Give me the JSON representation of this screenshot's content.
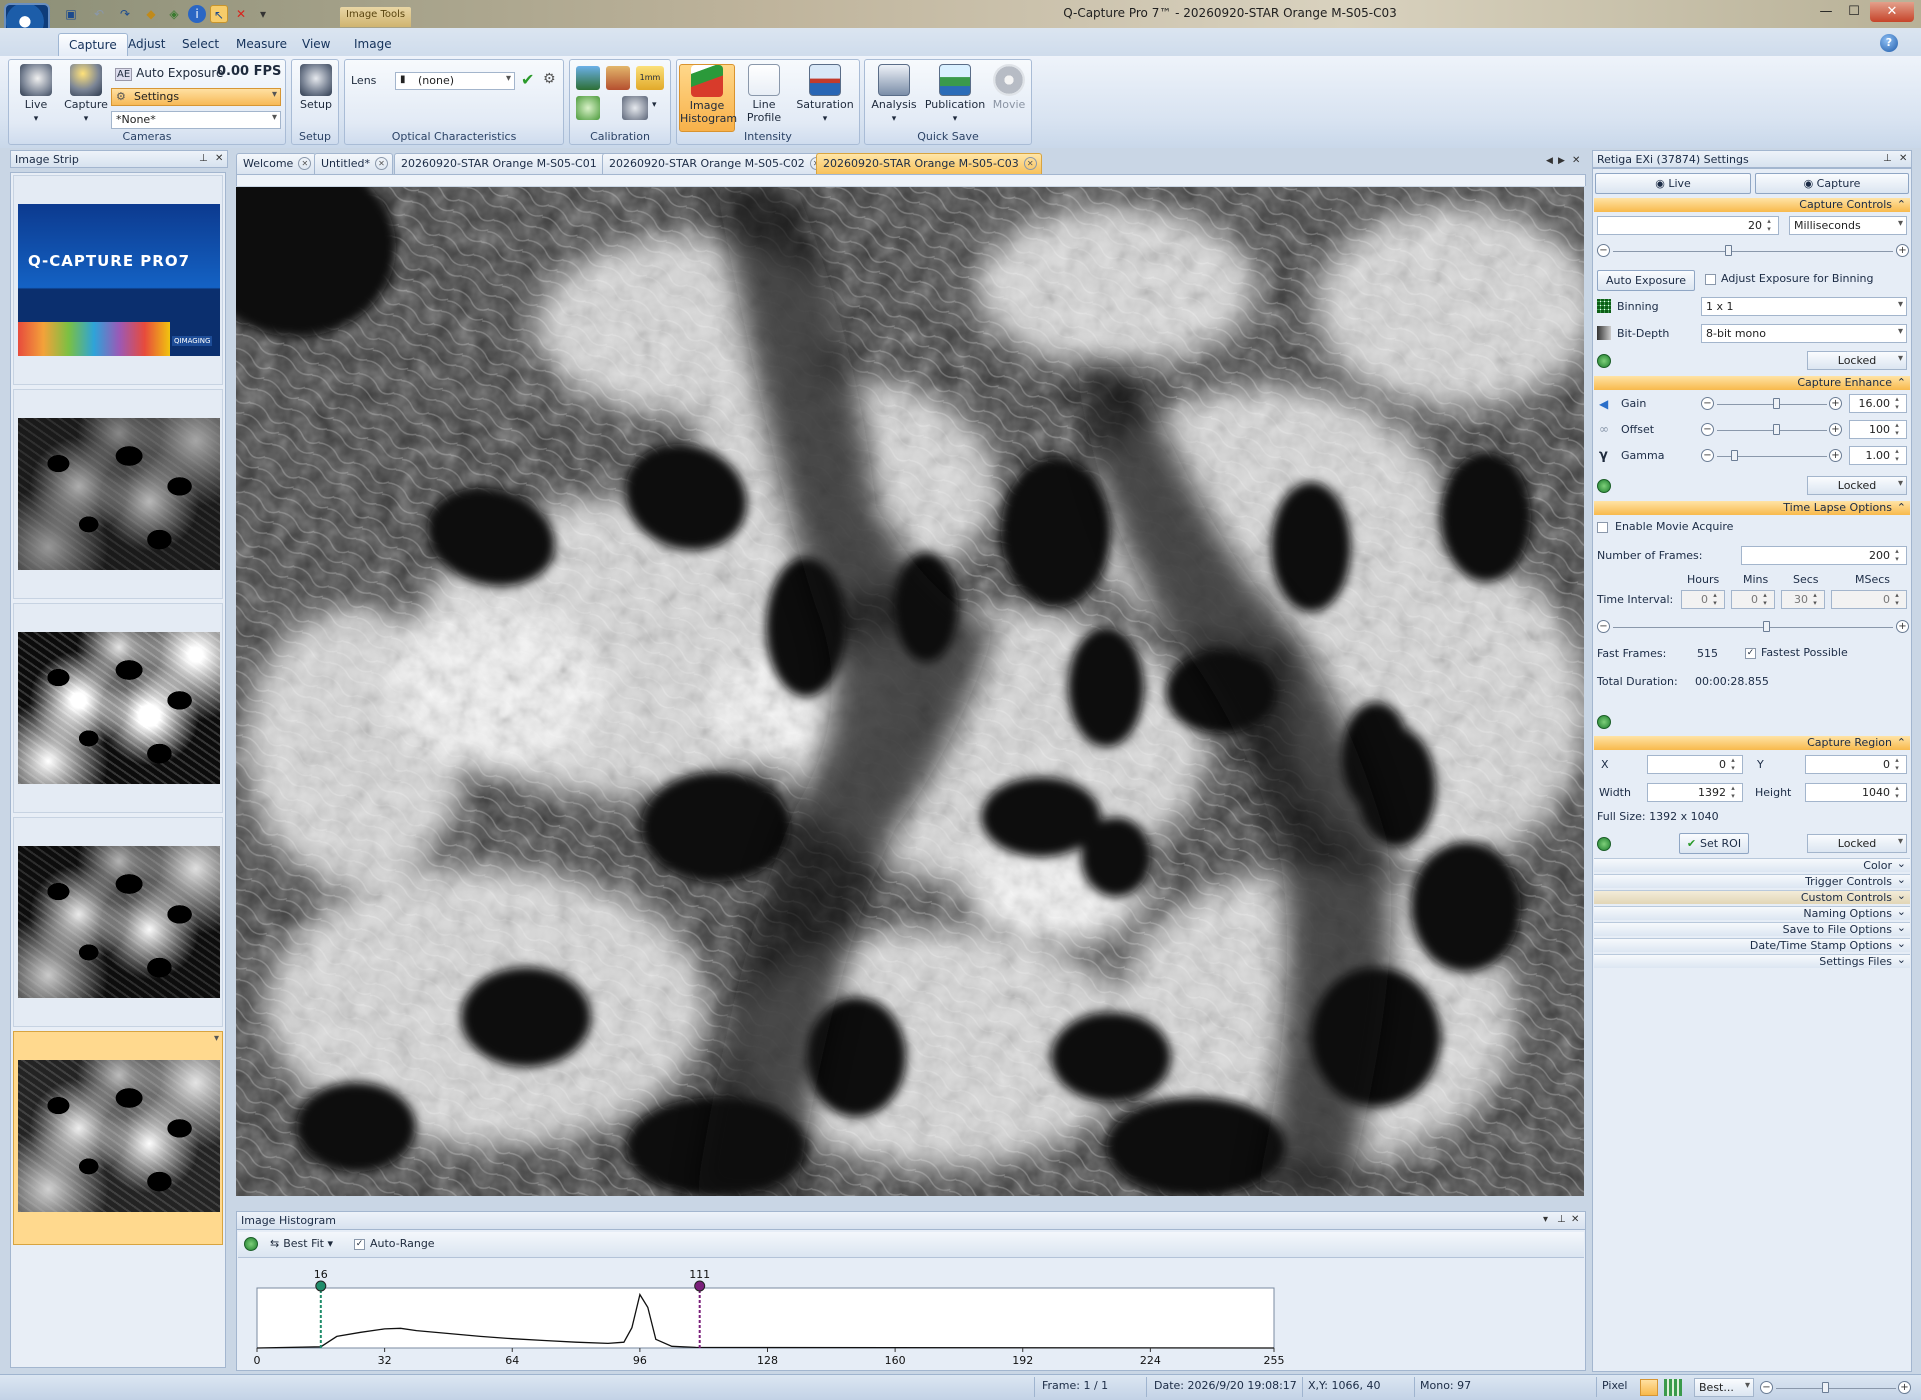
{
  "window": {
    "title": "Q-Capture Pro 7™ - 20260920-STAR Orange M-S05-C03",
    "context_tab": "Image Tools",
    "min": "—",
    "max": "☐",
    "close": "✕"
  },
  "ribbon": {
    "tabs": [
      "Capture",
      "Adjust",
      "Select",
      "Measure",
      "View",
      "Image"
    ],
    "help": "?",
    "cameras": {
      "live": "Live",
      "capture": "Capture",
      "auto_exposure": "Auto Exposure",
      "fps": "0.00 FPS",
      "settings_combo": "Settings",
      "preset_combo": "*None*",
      "label": "Cameras"
    },
    "setup": {
      "button": "Setup",
      "label": "Setup"
    },
    "optical": {
      "lens": "Lens",
      "lens_value": "(none)",
      "label": "Optical Characteristics"
    },
    "calibration": {
      "label": "Calibration"
    },
    "intensity": {
      "histogram": "Image Histogram",
      "line_profile": "Line Profile",
      "saturation": "Saturation",
      "label": "Intensity"
    },
    "quicksave": {
      "analysis": "Analysis",
      "publication": "Publication",
      "movie": "Movie",
      "label": "Quick Save"
    }
  },
  "image_strip": {
    "title": "Image Strip",
    "splash_text": "Q-CAPTURE PRO7",
    "splash_badge": "QIMAGING"
  },
  "doc_tabs": [
    {
      "label": "Welcome"
    },
    {
      "label": "Untitled*"
    },
    {
      "label": "20260920-STAR Orange M-S05-C01"
    },
    {
      "label": "20260920-STAR Orange M-S05-C02"
    },
    {
      "label": "20260920-STAR Orange M-S05-C03"
    }
  ],
  "histogram": {
    "title": "Image Histogram",
    "fit": "Best Fit",
    "auto_range": "Auto-Range",
    "low_marker": 16,
    "high_marker": 111,
    "x_ticks": [
      0,
      32,
      64,
      96,
      128,
      160,
      192,
      224,
      255
    ],
    "curve": [
      [
        0,
        0
      ],
      [
        16,
        0.02
      ],
      [
        20,
        0.2
      ],
      [
        26,
        0.27
      ],
      [
        32,
        0.33
      ],
      [
        36,
        0.34
      ],
      [
        40,
        0.3
      ],
      [
        48,
        0.25
      ],
      [
        56,
        0.2
      ],
      [
        64,
        0.16
      ],
      [
        72,
        0.13
      ],
      [
        80,
        0.1
      ],
      [
        88,
        0.08
      ],
      [
        92,
        0.1
      ],
      [
        94,
        0.35
      ],
      [
        96,
        0.92
      ],
      [
        98,
        0.7
      ],
      [
        100,
        0.15
      ],
      [
        104,
        0.03
      ],
      [
        110,
        0.01
      ],
      [
        255,
        0
      ]
    ]
  },
  "settings": {
    "title": "Retiga EXi (37874) Settings",
    "live_btn": "Live",
    "capture_btn": "Capture",
    "capture_controls": {
      "header": "Capture Controls",
      "exposure": "20",
      "unit": "Milliseconds",
      "auto_exposure_btn": "Auto Exposure",
      "adjust_binning": "Adjust Exposure for Binning",
      "binning_label": "Binning",
      "binning": "1 x 1",
      "bitdepth_label": "Bit-Depth",
      "bitdepth": "8-bit mono",
      "locked": "Locked"
    },
    "capture_enhance": {
      "header": "Capture Enhance",
      "gain_label": "Gain",
      "gain": "16.00",
      "offset_label": "Offset",
      "offset": "100",
      "gamma_label": "Gamma",
      "gamma": "1.00",
      "locked": "Locked"
    },
    "time_lapse": {
      "header": "Time Lapse Options",
      "enable_movie": "Enable Movie Acquire",
      "frames_label": "Number of Frames:",
      "frames": "200",
      "hours_h": "Hours",
      "mins_h": "Mins",
      "secs_h": "Secs",
      "msecs_h": "MSecs",
      "interval_label": "Time Interval:",
      "hours": "0",
      "mins": "0",
      "secs": "30",
      "msecs": "0",
      "fast_frames_label": "Fast Frames:",
      "fast_frames": "515",
      "fastest": "Fastest Possible",
      "total_label": "Total Duration:",
      "total": "00:00:28.855"
    },
    "capture_region": {
      "header": "Capture Region",
      "x_label": "X",
      "x": "0",
      "y_label": "Y",
      "y": "0",
      "w_label": "Width",
      "w": "1392",
      "h_label": "Height",
      "h": "1040",
      "full_size": "Full Size: 1392 x 1040",
      "set_roi": "Set ROI",
      "locked": "Locked"
    },
    "collapsed": [
      "Color",
      "Trigger Controls",
      "Custom Controls",
      "Naming Options",
      "Save to File Options",
      "Date/Time Stamp Options",
      "Settings Files"
    ]
  },
  "status": {
    "frame": "Frame: 1 / 1",
    "date": "Date: 2026/9/20 19:08:17",
    "xy": "X,Y: 1066,   40",
    "mono": "Mono:    97",
    "pixel": "Pixel",
    "zoom": "Best..."
  }
}
